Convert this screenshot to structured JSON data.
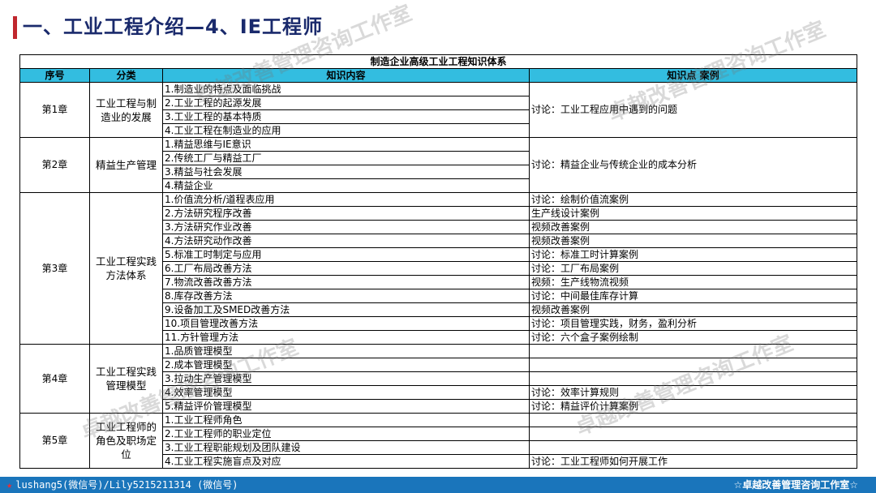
{
  "header": {
    "title": "一、工业工程介绍—4、IE工程师"
  },
  "table": {
    "caption": "制造企业高级工业工程知识体系",
    "columns": [
      "序号",
      "分类",
      "知识内容",
      "知识点 案例"
    ],
    "chapters": [
      {
        "chapter": "第1章",
        "category": "工业工程与制造业的发展",
        "items": [
          "1.制造业的特点及面临挑战",
          "2.工业工程的起源发展",
          "3.工业工程的基本特质",
          "4.工业工程在制造业的应用"
        ],
        "group_note": "讨论：工业工程应用中遇到的问题"
      },
      {
        "chapter": "第2章",
        "category": "精益生产管理",
        "items": [
          "1.精益思维与IE意识",
          "2.传统工厂与精益工厂",
          "3.精益与社会发展",
          "4.精益企业"
        ],
        "group_note": "讨论：精益企业与传统企业的成本分析"
      },
      {
        "chapter": "第3章",
        "category": "工业工程实践方法体系",
        "items": [
          "1.价值流分析/道程表应用",
          "2.方法研究程序改善",
          "3.方法研究作业改善",
          "4.方法研究动作改善",
          "5.标准工时制定与应用",
          "6.工厂布局改善方法",
          "7.物流改善改善方法",
          "8.库存改善方法",
          "9.设备加工及SMED改善方法",
          "10.项目管理改善方法",
          "11.方针管理方法"
        ],
        "notes": [
          "讨论：绘制价值流案例",
          "生产线设计案例",
          "视频改善案例",
          "视频改善案例",
          "讨论：标准工时计算案例",
          "讨论：工厂布局案例",
          "视频：生产线物流视频",
          "讨论：中间最佳库存计算",
          "视频改善案例",
          "讨论：项目管理实践，财务，盈利分析",
          "讨论：六个盒子案例绘制"
        ]
      },
      {
        "chapter": "第4章",
        "category": "工业工程实践管理模型",
        "items": [
          "1.品质管理模型",
          "2.成本管理模型",
          "3.拉动生产管理模型",
          "4.效率管理模型",
          "5.精益评价管理模型"
        ],
        "notes": [
          "",
          "",
          "",
          "讨论：效率计算规则",
          "讨论：精益评价计算案例"
        ]
      },
      {
        "chapter": "第5章",
        "category": "工业工程师的角色及职场定位",
        "items": [
          "1.工业工程师角色",
          "2.工业工程师的职业定位",
          "3.工业工程职能规划及团队建设",
          "4.工业工程实施盲点及对应"
        ],
        "notes": [
          "",
          "",
          "",
          "讨论：工业工程师如何开展工作"
        ]
      }
    ]
  },
  "watermarks": [
    "卓越改善管理咨询工作室",
    "卓越改善管理咨询工作室",
    "卓越改善管理咨询工作室",
    "卓越改善管理咨询工作室"
  ],
  "footer": {
    "left": "lushang5(微信号)/Lily5215211314 (微信号)",
    "right": "☆卓越改善管理咨询工作室☆"
  },
  "colors": {
    "title": "#1a2a6c",
    "title_bar": "#c0262d",
    "header_fill": "#33bde0",
    "footer_fill": "#1a75bb"
  }
}
